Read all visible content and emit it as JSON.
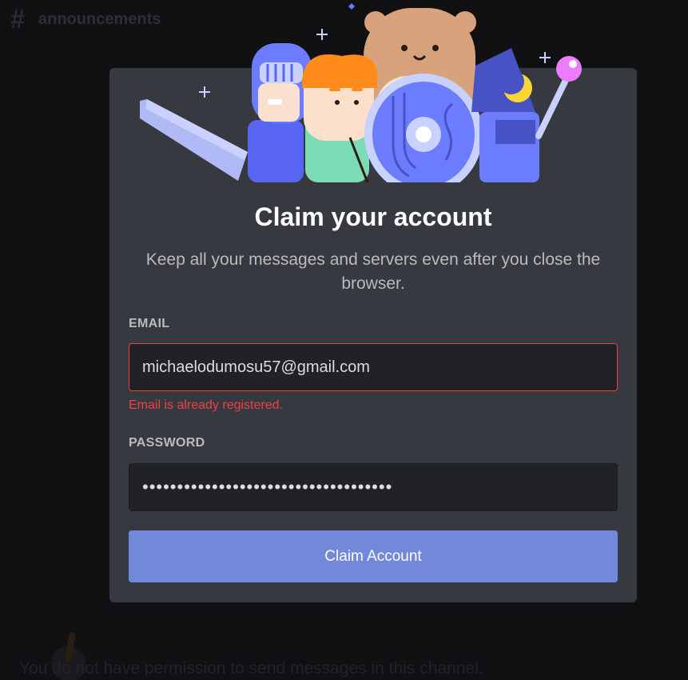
{
  "channel": {
    "hash": "#",
    "name": "announcements"
  },
  "background_note": "You do not have permission to send messages in this channel.",
  "modal": {
    "title": "Claim your account",
    "subtitle": "Keep all your messages and servers even after you close the browser.",
    "email": {
      "label": "EMAIL",
      "value": "michaelodumosu57@gmail.com",
      "error": "Email is already registered."
    },
    "password": {
      "label": "PASSWORD",
      "value": "••••••••••••••••••••••••••••••••••••"
    },
    "claim_button": "Claim Account"
  },
  "colors": {
    "modal_bg": "#36393f",
    "input_bg": "#202225",
    "error": "#ed4245",
    "button": "#7289da",
    "title": "#ffffff",
    "subtitle": "#b9bbbe"
  },
  "icons": [
    "hashtag-icon",
    "hero-illustration",
    "sparkle-icon"
  ]
}
